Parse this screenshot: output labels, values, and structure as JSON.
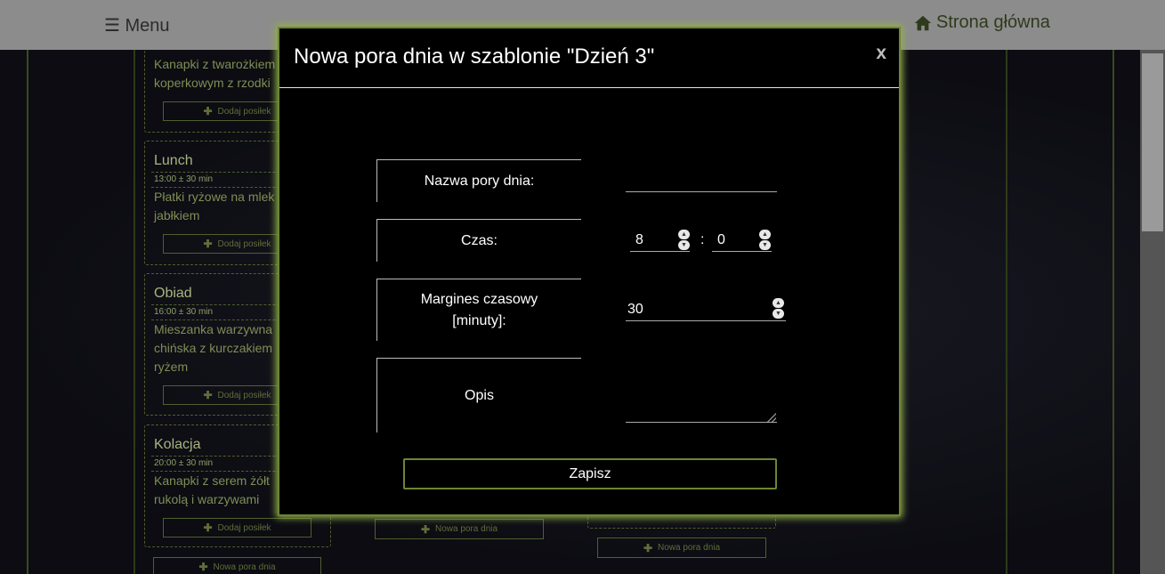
{
  "topbar": {
    "menu_label": "☰ Menu",
    "home_label": "Strona główna"
  },
  "background": {
    "meals": [
      {
        "desc_lines": [
          "Kanapki z twarożkiem",
          "koperkowym z rzodki"
        ]
      },
      {
        "title": "Lunch",
        "time": "13:00 ± 30 min",
        "desc_lines": [
          "Płatki ryżowe na mlek",
          "jabłkiem"
        ]
      },
      {
        "title": "Obiad",
        "time": "16:00 ± 30 min",
        "desc_lines": [
          "Mieszanka warzywna",
          "chińska z kurczakiem",
          "ryżem"
        ]
      },
      {
        "title": "Kolacja",
        "time": "20:00 ± 30 min",
        "desc_lines": [
          "Kanapki z serem żółt",
          "rukolą i warzywami"
        ]
      }
    ],
    "add_meal_label": "Dodaj posiłek",
    "new_daytime_label": "Nowa pora dnia"
  },
  "modal": {
    "title": "Nowa pora dnia w szablonie \"Dzień 3\"",
    "close_label": "x",
    "fields": {
      "name_label": "Nazwa pory dnia:",
      "name_value": "",
      "time_label": "Czas:",
      "hour_value": "8",
      "minute_value": "0",
      "time_separator": ":",
      "margin_label_line1": "Margines czasowy",
      "margin_label_line2": "[minuty]:",
      "margin_value": "30",
      "description_label": "Opis",
      "description_value": ""
    },
    "save_label": "Zapisz"
  },
  "colors": {
    "accent_green": "#6d8536",
    "glow_green": "#93b04a",
    "topbar_gray": "#8c8c8c"
  },
  "icons": {
    "home": "home-icon",
    "plus": "plus-icon",
    "spinner": "spinner-arrows-icon"
  }
}
